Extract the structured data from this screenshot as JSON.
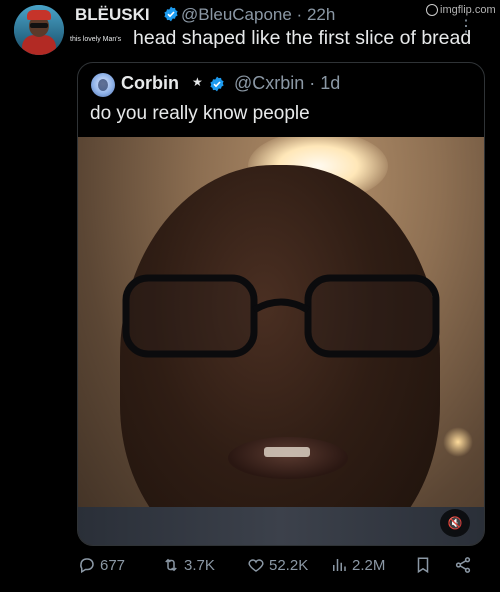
{
  "header": {
    "display_name": "BLËUSKI",
    "handle_time": "@BleuCapone · 22h",
    "watermark": "imgflip.com",
    "more_icon": "more-dots-icon"
  },
  "tweet": {
    "small_text": "this lovely Man's",
    "big_text": "head shaped like the first slice of bread"
  },
  "quote": {
    "display_name": "Corbin",
    "star": "★",
    "handle_time": "@Cxrbin · 1d",
    "text": "do you really know people"
  },
  "video": {
    "mute_icon": "speaker-muted-icon"
  },
  "actions": {
    "replies": "677",
    "reposts": "3.7K",
    "likes": "52.2K",
    "views": "2.2M"
  },
  "colors": {
    "background": "#000000",
    "text": "#e7e9ea",
    "secondary": "#8b98a5",
    "verified": "#1d9bf0",
    "border": "#2f3336"
  }
}
